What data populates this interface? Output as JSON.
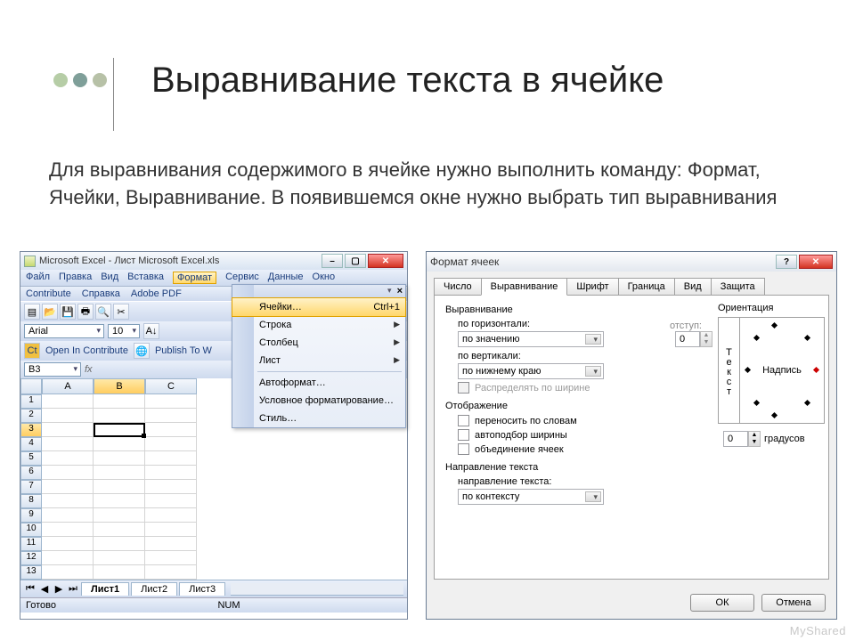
{
  "decor_colors": [
    "#b6cda6",
    "#7f9f99",
    "#b7c1a7"
  ],
  "slide": {
    "title": "Выравнивание текста в ячейке",
    "body": "Для выравнивания содержимого в ячейке нужно выполнить команду: Формат, Ячейки, Выравнивание. В появившемся окне нужно выбрать тип выравнивания"
  },
  "excel": {
    "title": "Microsoft Excel - Лист Microsoft Excel.xls",
    "menu": [
      "Файл",
      "Правка",
      "Вид",
      "Вставка",
      "Формат",
      "Сервис",
      "Данные",
      "Окно"
    ],
    "row2": [
      "Contribute",
      "Справка",
      "Adobe PDF"
    ],
    "font_name": "Arial",
    "font_size": "10",
    "link1": "Open In Contribute",
    "link2": "Publish To W",
    "namebox": "B3",
    "fx": "fx",
    "dropdown_close": "×",
    "columns": [
      "A",
      "B",
      "C"
    ],
    "rows": [
      "1",
      "2",
      "3",
      "4",
      "5",
      "6",
      "7",
      "8",
      "9",
      "10",
      "11",
      "12",
      "13"
    ],
    "selected": "B3",
    "tabs_nav": [
      "◂",
      "◂",
      "▸",
      "▸"
    ],
    "sheets": [
      "Лист1",
      "Лист2",
      "Лист3"
    ],
    "status_left": "Готово",
    "status_mid": "NUM",
    "dropdown": {
      "items": [
        {
          "label": "Ячейки…",
          "accel": "Ctrl+1",
          "hi": true
        },
        {
          "label": "Строка",
          "sub": true
        },
        {
          "label": "Столбец",
          "sub": true
        },
        {
          "label": "Лист",
          "sub": true
        },
        {
          "sep": true
        },
        {
          "label": "Автоформат…"
        },
        {
          "label": "Условное форматирование…"
        },
        {
          "label": "Стиль…"
        }
      ]
    }
  },
  "dialog": {
    "title": "Формат ячеек",
    "help": "?",
    "tabs": [
      "Число",
      "Выравнивание",
      "Шрифт",
      "Граница",
      "Вид",
      "Защита"
    ],
    "active_tab": 1,
    "grp_align": "Выравнивание",
    "h_label": "по горизонтали:",
    "h_value": "по значению",
    "v_label": "по вертикали:",
    "v_value": "по нижнему краю",
    "indent_label": "отступ:",
    "indent_value": "0",
    "chk_dist": "Распределять по ширине",
    "grp_disp": "Отображение",
    "chk1": "переносить по словам",
    "chk2": "автоподбор ширины",
    "chk3": "объединение ячеек",
    "grp_dir": "Направление текста",
    "dir_label": "направление текста:",
    "dir_value": "по контексту",
    "grp_orient": "Ориентация",
    "vtext": "Текст",
    "dial_label": "Надпись",
    "deg_value": "0",
    "deg_label": "градусов",
    "ok": "ОК",
    "cancel": "Отмена"
  },
  "watermark": "MyShared"
}
